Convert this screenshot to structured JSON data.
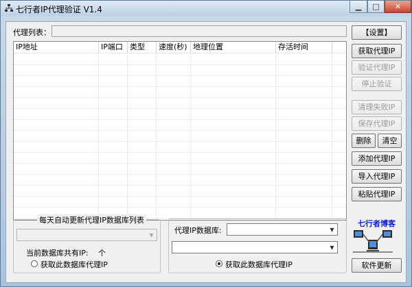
{
  "window": {
    "title": "七行者IP代理验证 V1.4",
    "min_glyph": "▁",
    "max_glyph": "□",
    "close_glyph": "✕"
  },
  "proxy_list": {
    "label": "代理列表：",
    "value": ""
  },
  "table": {
    "columns": [
      "IP地址",
      "IP端口",
      "类型",
      "速度(秒)",
      "地理位置",
      "存活时间"
    ],
    "rows": []
  },
  "buttons": {
    "settings": "【设置】",
    "get_proxy_ip": "获取代理IP",
    "verify_proxy_ip": "验证代理IP",
    "stop_verify": "停止验证",
    "clean_failed_ip": "清理失败IP",
    "save_proxy_ip": "保存代理IP",
    "delete": "删除",
    "clear": "清空",
    "add_proxy_ip": "添加代理IP",
    "import_proxy_ip": "导入代理IP",
    "paste_proxy_ip": "粘贴代理IP",
    "software_update": "软件更新"
  },
  "daily_group": {
    "title": "每天自动更新代理IP数据库列表",
    "combo_value": "",
    "db_count_label": "当前数据库共有IP:",
    "db_count_unit": "个",
    "radio_label": "获取此数据库代理IP",
    "radio_checked": false
  },
  "proxy_db_group": {
    "label": "代理IP数据库:",
    "combo1_value": "",
    "combo2_value": "",
    "radio_label": "获取此数据库代理IP",
    "radio_checked": true
  },
  "blog": {
    "label": "七行者博客"
  }
}
